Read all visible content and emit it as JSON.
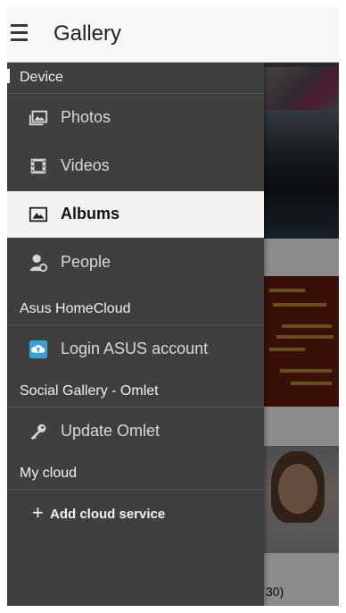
{
  "appbar": {
    "title": "Gallery"
  },
  "drawer": {
    "sections": [
      {
        "header": "Device"
      },
      {
        "header": "Asus HomeCloud"
      },
      {
        "header": "Social Gallery - Omlet"
      },
      {
        "header": "My cloud"
      }
    ],
    "device_items": [
      {
        "label": "Photos",
        "icon": "photos-icon"
      },
      {
        "label": "Videos",
        "icon": "film-icon"
      },
      {
        "label": "Albums",
        "icon": "albums-icon",
        "selected": true
      },
      {
        "label": "People",
        "icon": "people-icon"
      }
    ],
    "homecloud_items": [
      {
        "label": "Login ASUS account",
        "icon": "cloud-upload-icon"
      }
    ],
    "omlet_items": [
      {
        "label": "Update Omlet",
        "icon": "key-icon"
      }
    ],
    "add_cloud": {
      "label": "Add cloud service",
      "icon": "plus-icon"
    }
  },
  "background": {
    "visible_label": "30)"
  },
  "colors": {
    "drawer_bg": "#3f3f3f",
    "selected_bg": "#f2f2f2",
    "appbar_bg": "#f7f7f7",
    "cloud_icon": "#3aa0d8"
  }
}
